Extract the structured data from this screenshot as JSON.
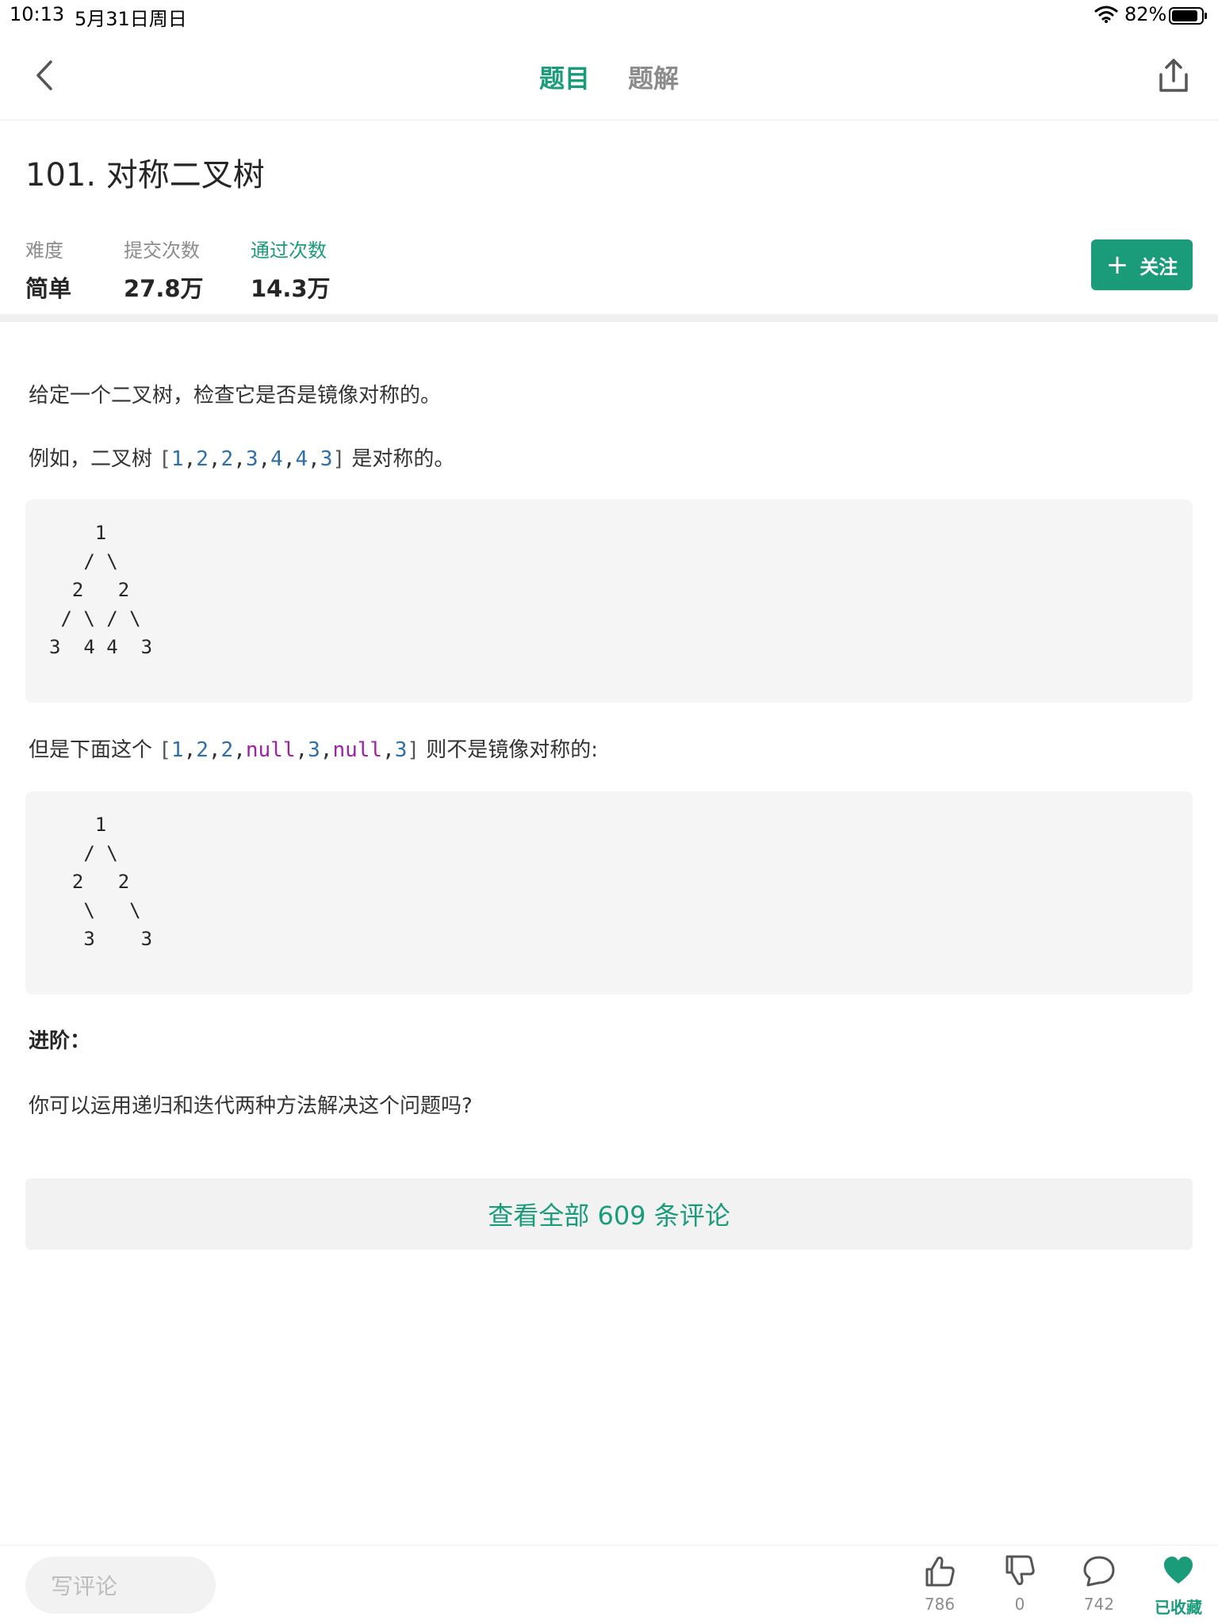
{
  "status": {
    "time": "10:13",
    "date": "5月31日周日",
    "battery": "82%"
  },
  "nav": {
    "tabs": [
      "题目",
      "题解"
    ],
    "active_tab": "题目"
  },
  "problem": {
    "title": "101. 对称二叉树",
    "stats": {
      "difficulty_label": "难度",
      "difficulty_value": "简单",
      "submit_label": "提交次数",
      "submit_value": "27.8万",
      "pass_label": "通过次数",
      "pass_value": "14.3万"
    },
    "follow_label": "关注",
    "description": {
      "p1": "给定一个二叉树，检查它是否是镜像对称的。",
      "p2_prefix": "例如，二叉树 ",
      "p2_suffix": " 是对称的。",
      "p3_prefix": "但是下面这个 ",
      "p3_suffix": " 则不是镜像对称的:",
      "advanced_title": "进阶：",
      "advanced_text": "你可以运用递归和迭代两种方法解决这个问题吗?"
    },
    "example1_array": [
      "1",
      "2",
      "2",
      "3",
      "4",
      "4",
      "3"
    ],
    "example2_array": [
      "1",
      "2",
      "2",
      "null",
      "3",
      "null",
      "3"
    ],
    "tree1": "    1\n   / \\\n  2   2\n / \\ / \\\n3  4 4  3",
    "tree2": "    1\n   / \\\n  2   2\n   \\   \\\n   3    3"
  },
  "comments_button": "查看全部 609 条评论",
  "bottom": {
    "comment_placeholder": "写评论",
    "likes": "786",
    "dislikes": "0",
    "comments": "742",
    "favorite_label": "已收藏"
  },
  "colors": {
    "accent": "#1a9c7a",
    "code_number": "#2f6fa8",
    "code_keyword": "#a020a8"
  }
}
